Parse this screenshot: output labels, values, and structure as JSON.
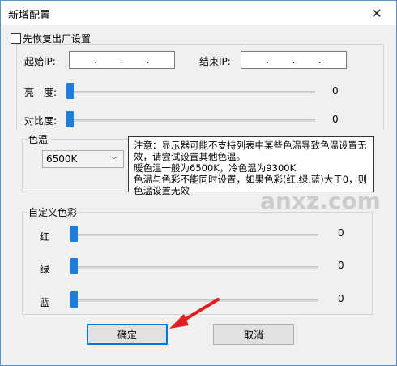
{
  "window": {
    "title": "新增配置",
    "close_glyph": "✕"
  },
  "factory_reset": {
    "label": "先恢复出厂设置",
    "checked": false
  },
  "ip": {
    "start_label": "起始IP:",
    "end_label": "结束IP:",
    "start_dots": [
      ".",
      ".",
      "."
    ],
    "end_dots": [
      ".",
      ".",
      "."
    ]
  },
  "brightness": {
    "label": "亮　度:",
    "value": "0"
  },
  "contrast": {
    "label": "对比度:",
    "value": "0"
  },
  "color_temp": {
    "group_label": "色温",
    "selected": "6500K",
    "note": "注意：显示器可能不支持列表中某些色温导致色温设置无效，请尝试设置其他色温。\n暖色温一般为6500K，冷色温为9300K\n色温与色彩不能同时设置，如果色彩(红,绿,蓝)大于0，则色温设置无效"
  },
  "custom_color": {
    "group_label": "自定义色彩",
    "red": {
      "label": "红",
      "value": "0"
    },
    "green": {
      "label": "绿",
      "value": "0"
    },
    "blue": {
      "label": "蓝",
      "value": "0"
    }
  },
  "buttons": {
    "ok": "确定",
    "cancel": "取消"
  },
  "watermark": {
    "text": "anxz.com"
  },
  "colors": {
    "accent": "#1e7ed8",
    "arrow": "#e02020"
  }
}
